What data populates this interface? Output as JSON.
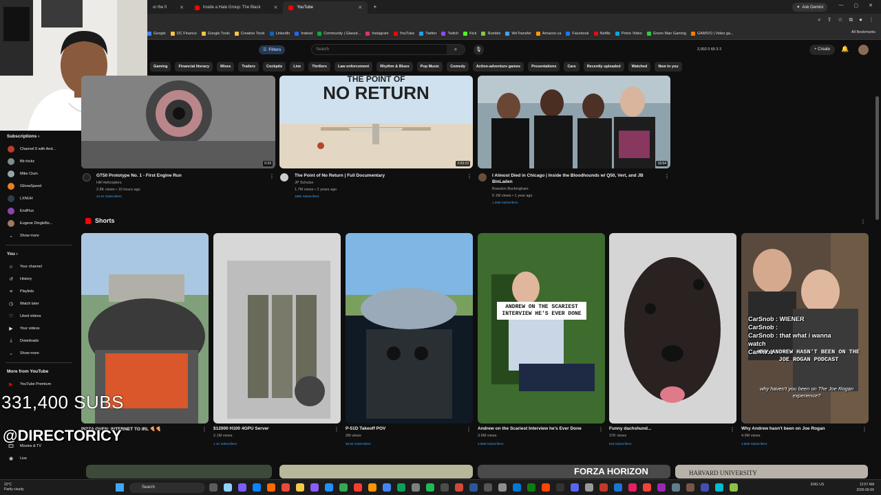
{
  "browser": {
    "tabs": [
      {
        "label": "or the fi",
        "active": false
      },
      {
        "label": "Inside a Hate Group: The Black",
        "active": false
      },
      {
        "label": "YouTube",
        "active": true
      }
    ],
    "ask_gemini": "Ask Gemini",
    "all_bookmarks": "All Bookmarks",
    "bookmarks": [
      {
        "label": "Google",
        "color": "#4285f4"
      },
      {
        "label": "DC Finance",
        "color": "#f6c343"
      },
      {
        "label": "Google Tools",
        "color": "#f6c343"
      },
      {
        "label": "Creative Tools",
        "color": "#f6c343"
      },
      {
        "label": "LinkedIn",
        "color": "#0a66c2"
      },
      {
        "label": "Indeed",
        "color": "#2164f3"
      },
      {
        "label": "Community | Glassd...",
        "color": "#0caa41"
      },
      {
        "label": "Instagram",
        "color": "#e1306c"
      },
      {
        "label": "YouTube",
        "color": "#ff0000"
      },
      {
        "label": "Twitter",
        "color": "#1da1f2"
      },
      {
        "label": "Twitch",
        "color": "#9146ff"
      },
      {
        "label": "Kick",
        "color": "#53fc18"
      },
      {
        "label": "Rumble",
        "color": "#85c742"
      },
      {
        "label": "WeTransfer",
        "color": "#409fff"
      },
      {
        "label": "Amazon.ca",
        "color": "#ff9900"
      },
      {
        "label": "Facebook",
        "color": "#1877f2"
      },
      {
        "label": "Netflix",
        "color": "#e50914"
      },
      {
        "label": "Prime Video",
        "color": "#00a8e1"
      },
      {
        "label": "Green Man Gaming",
        "color": "#2ecc40"
      },
      {
        "label": "GAMIVO | Video ga...",
        "color": "#f57c00"
      }
    ]
  },
  "header": {
    "filters": "Filters",
    "search_placeholder": "Search",
    "stats": "2,002  0  60  3  2",
    "create": "+ Create"
  },
  "chips": [
    "Gaming",
    "Financial literacy",
    "Mixes",
    "Trailers",
    "Cockpits",
    "Live",
    "Thrillers",
    "Law enforcement",
    "Rhythm & Blues",
    "Pop Music",
    "Comedy",
    "Action-adventure games",
    "Presentations",
    "Cars",
    "Recently uploaded",
    "Watched",
    "New to you"
  ],
  "sidebar": {
    "subscriptions_header": "Subscriptions",
    "subscriptions": [
      {
        "label": "Channel 5 with And...",
        "color": "#c0392b"
      },
      {
        "label": "Bb trickz",
        "color": "#7f8c8d"
      },
      {
        "label": "Mike Clum",
        "color": "#95a5a6"
      },
      {
        "label": "IShowSpeed",
        "color": "#e67e22"
      },
      {
        "label": "LXNUH",
        "color": "#2c3e50"
      },
      {
        "label": "EndFlux",
        "color": "#8e44ad"
      },
      {
        "label": "Eugene DingleBe...",
        "color": "#a0785a"
      }
    ],
    "show_more": "Show more",
    "you_header": "You",
    "you_items": [
      {
        "label": "Your channel",
        "icon": "☺"
      },
      {
        "label": "History",
        "icon": "↺"
      },
      {
        "label": "Playlists",
        "icon": "≡"
      },
      {
        "label": "Watch later",
        "icon": "◷"
      },
      {
        "label": "Liked videos",
        "icon": "♡"
      },
      {
        "label": "Your videos",
        "icon": "▶"
      },
      {
        "label": "Downloads",
        "icon": "⤓"
      }
    ],
    "show_more_2": "Show more",
    "more_header": "More from YouTube",
    "more_items": [
      {
        "label": "YouTube Premium"
      },
      {
        "label": "Movies & TV"
      },
      {
        "label": "Live"
      }
    ]
  },
  "videos": [
    {
      "title": "GT50 Prototype No. 1 - First Engine Run",
      "channel": "Hill Helicopters",
      "meta": "2.8K views • 10 hours ago",
      "subs": "34.1K Subscribers",
      "duration": "0:33"
    },
    {
      "title": "The Point of No Return | Full Documentary",
      "channel": "JP Schulze",
      "meta": "1.7M views • 2 years ago",
      "subs": "186K Subscribers",
      "duration": "2:03:23",
      "thumb_text": [
        "THE POINT OF",
        "NO RETURN"
      ]
    },
    {
      "title": "I Almost Died in Chicago | Inside the Bloodhounds w/ Q50, Vert, and JB",
      "title2": "BinLaden",
      "channel": "Brandon Buckingham",
      "meta": "6.1M views • 1 year ago",
      "subs": "1.33M Subscribers",
      "duration": "16:54"
    }
  ],
  "shorts_header": "Shorts",
  "shorts": [
    {
      "title": "PIZZA OVEN: INTERNET TO IRL 🍕🍕",
      "views": "",
      "subs": ""
    },
    {
      "title": "$12000 H100 4GPU Server",
      "views": "2.1M views",
      "subs": "1.1K Subscribers"
    },
    {
      "title": "P-51D Takeoff POV",
      "views": "2M views",
      "subs": "36.5K Subscribers"
    },
    {
      "title": "Andrew on the Scariest Interview he's Ever Done",
      "views": "3.6M views",
      "subs": "3.66M Subscribers",
      "caption": "ANDREW ON THE SCARIEST INTERVIEW HE'S EVER DONE"
    },
    {
      "title": "Funny dachshund...",
      "views": "37K views",
      "subs": "618 Subscribers"
    },
    {
      "title": "Why Andrew hasn't been on Joe Rogan",
      "views": "4.9M views",
      "subs": "3.66M Subscribers",
      "chat": [
        "CarSnob : WIENER",
        "CarSnob :",
        "CarSnob : that what i wanna",
        "watch",
        "CarSnob :"
      ],
      "caption": "WHY ANDREW HASN'T BEEN ON THE JOE ROGAN PODCAST",
      "caption2": "why haven't you been on The Joe Rogan experience?"
    }
  ],
  "bottom_row_text": [
    "FORZA HORIZON",
    "HARVARD UNIVERSITY"
  ],
  "overlay": {
    "subs": "331,400 SUBS",
    "handle": "@DIRECTORICY"
  },
  "taskbar": {
    "weather_temp": "22°C",
    "weather_desc": "Partly cloudy",
    "search": "Search",
    "lang": "ENG US",
    "time": "12:57 AM",
    "date": "2026-06-06"
  }
}
